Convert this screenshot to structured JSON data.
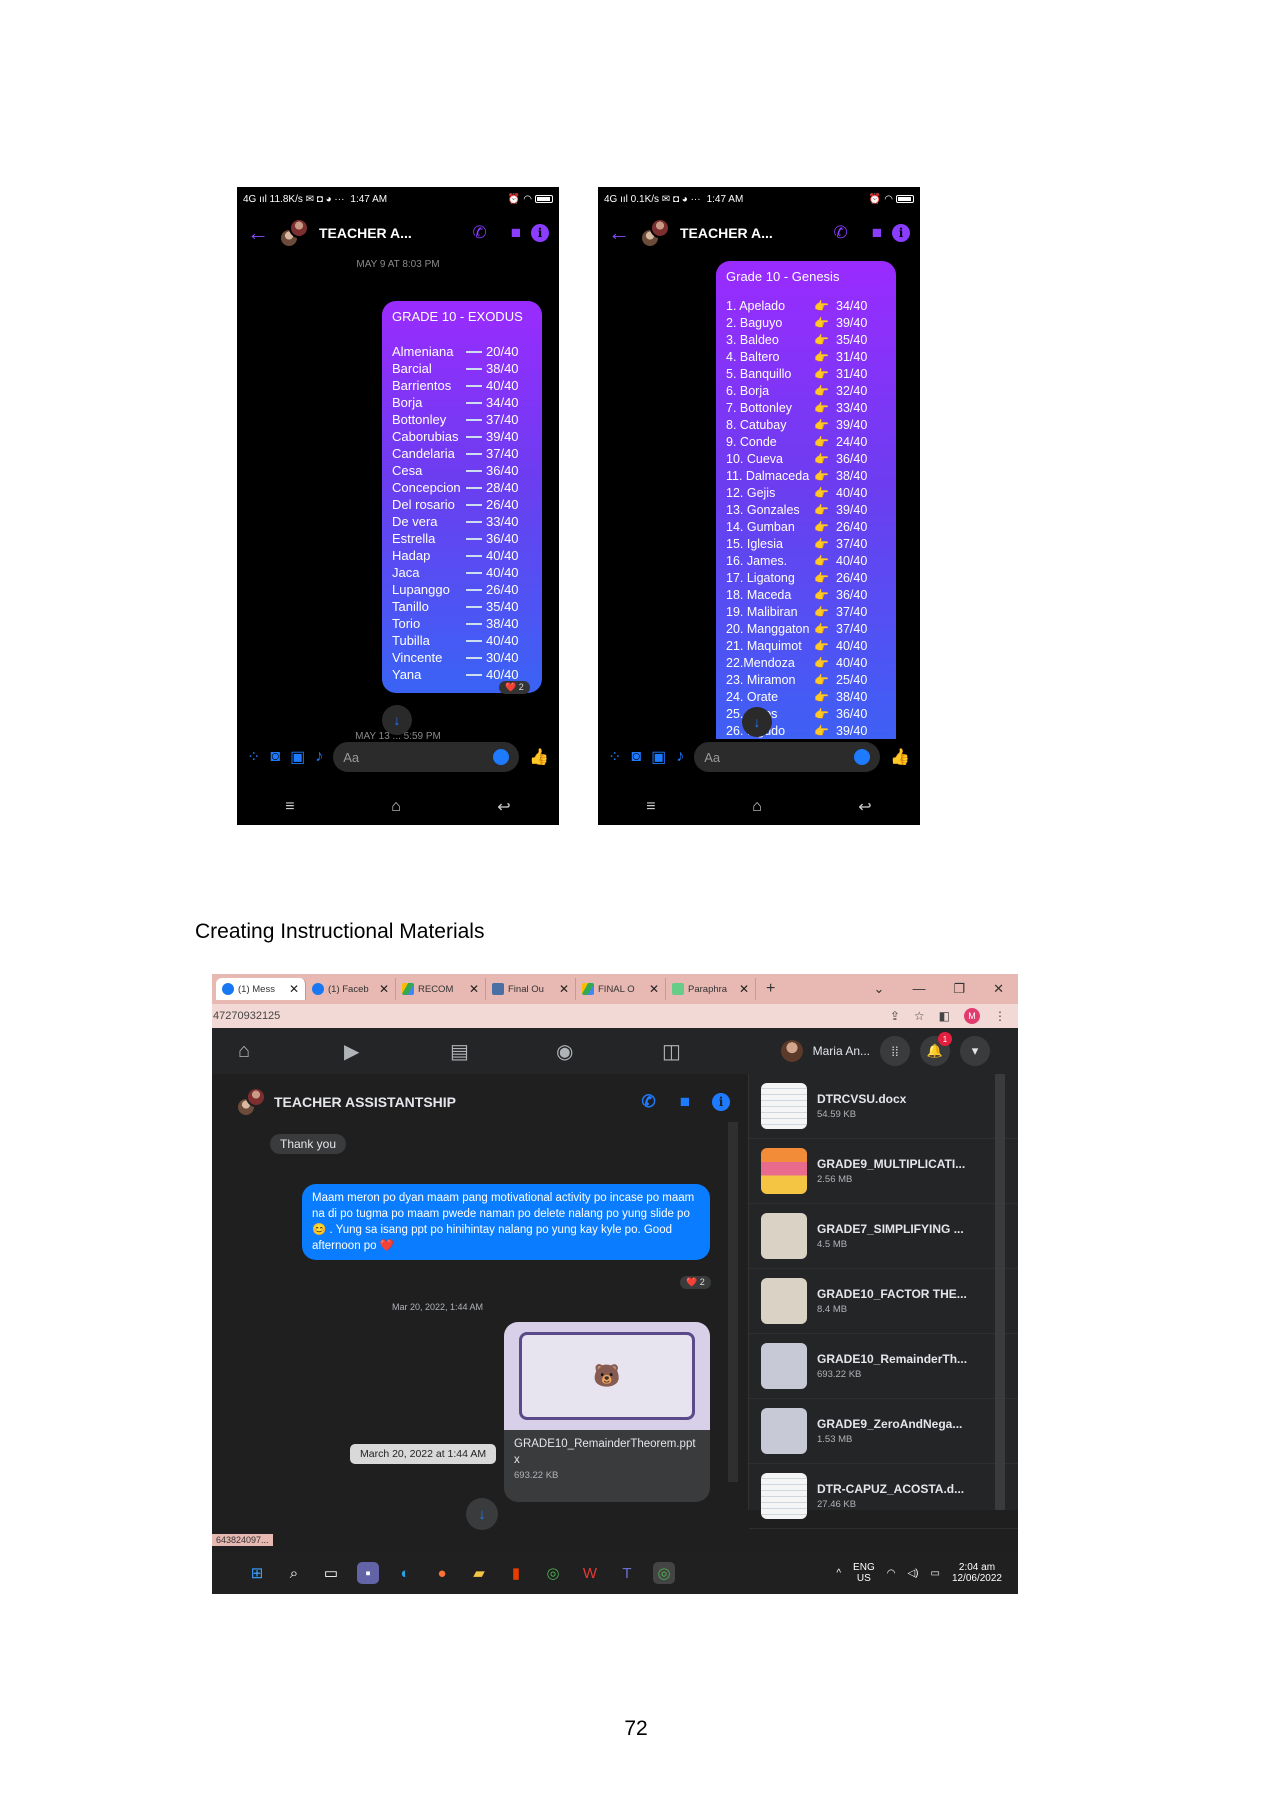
{
  "phone1": {
    "status_left": "4G ııl  11.8K/s ✉ ◘ ◕ ···",
    "status_time": "1:47 AM",
    "chat_title": "TEACHER A...",
    "timestamp_top": "MAY 9 AT 8:03 PM",
    "bubble_title": "GRADE 10 - EXODUS",
    "scores": [
      {
        "name": "Almeniana",
        "score": "20/40"
      },
      {
        "name": "Barcial",
        "score": "38/40"
      },
      {
        "name": "Barrientos",
        "score": "40/40"
      },
      {
        "name": "Borja",
        "score": "34/40"
      },
      {
        "name": "Bottonley",
        "score": "37/40"
      },
      {
        "name": "Caborubias",
        "score": "39/40"
      },
      {
        "name": "Candelaria",
        "score": "37/40"
      },
      {
        "name": "Cesa",
        "score": "36/40"
      },
      {
        "name": "Concepcion",
        "score": "28/40"
      },
      {
        "name": "Del rosario",
        "score": "26/40"
      },
      {
        "name": "De vera",
        "score": "33/40"
      },
      {
        "name": "Estrella",
        "score": "36/40"
      },
      {
        "name": "Hadap",
        "score": "40/40"
      },
      {
        "name": "Jaca",
        "score": "40/40"
      },
      {
        "name": "Lupanggo",
        "score": "26/40"
      },
      {
        "name": "Tanillo",
        "score": "35/40"
      },
      {
        "name": "Torio",
        "score": "38/40"
      },
      {
        "name": "Tubilla",
        "score": "40/40"
      },
      {
        "name": "Vincente",
        "score": "30/40"
      },
      {
        "name": "Yana",
        "score": "40/40"
      }
    ],
    "reaction": "❤️ 2",
    "timestamp_bottom": "MAY 13 ... 5:59 PM",
    "compose_placeholder": "Aa"
  },
  "phone2": {
    "status_left": "4G ııl  0.1K/s ✉ ◘ ◕ ···",
    "status_time": "1:47 AM",
    "chat_title": "TEACHER A...",
    "bubble_title": "Grade 10 - Genesis",
    "scores": [
      {
        "name": "1. Apelado",
        "score": "34/40"
      },
      {
        "name": "2. Baguyo",
        "score": "39/40"
      },
      {
        "name": "3. Baldeo",
        "score": "35/40"
      },
      {
        "name": "4. Baltero",
        "score": "31/40"
      },
      {
        "name": "5. Banquillo",
        "score": "31/40"
      },
      {
        "name": "6. Borja",
        "score": "32/40"
      },
      {
        "name": "7. Bottonley",
        "score": "33/40"
      },
      {
        "name": "8. Catubay",
        "score": "39/40"
      },
      {
        "name": "9. Conde",
        "score": "24/40"
      },
      {
        "name": "10. Cueva",
        "score": "36/40"
      },
      {
        "name": "11. Dalmaceda",
        "score": "38/40"
      },
      {
        "name": "12. Gejis",
        "score": "40/40"
      },
      {
        "name": "13. Gonzales",
        "score": "39/40"
      },
      {
        "name": "14. Gumban",
        "score": "26/40"
      },
      {
        "name": "15. Iglesia",
        "score": "37/40"
      },
      {
        "name": "16. James.",
        "score": "40/40"
      },
      {
        "name": "17. Ligatong",
        "score": "26/40"
      },
      {
        "name": "18. Maceda",
        "score": "36/40"
      },
      {
        "name": "19. Malibiran",
        "score": "37/40"
      },
      {
        "name": "20. Manggaton",
        "score": "37/40"
      },
      {
        "name": "21. Maquimot",
        "score": "40/40"
      },
      {
        "name": "22.Mendoza",
        "score": "40/40"
      },
      {
        "name": "23. Miramon",
        "score": "25/40"
      },
      {
        "name": "24. Orate",
        "score": "38/40"
      },
      {
        "name": "25. ...nos",
        "score": "36/40"
      },
      {
        "name": "26. ...gudo",
        "score": "39/40"
      }
    ],
    "compose_placeholder": "Aa"
  },
  "section_heading": "Creating Instructional Materials",
  "desktop": {
    "tabs": [
      {
        "label": "(1) Mess",
        "icon": "facebook-icon"
      },
      {
        "label": "(1) Faceb",
        "icon": "facebook-icon"
      },
      {
        "label": "RECOM",
        "icon": "google-drive-icon"
      },
      {
        "label": "Final Ou",
        "icon": "slides-icon"
      },
      {
        "label": "FINAL O",
        "icon": "google-drive-icon"
      },
      {
        "label": "Paraphra",
        "icon": "paraphrase-icon"
      }
    ],
    "address": "47270932125",
    "profile_initial": "M",
    "user_name": "Maria An...",
    "notification_count": "1",
    "chat_title": "TEACHER ASSISTANTSHIP",
    "thank_you": "Thank you",
    "blue_message": "Maam meron po dyan maam pang motivational activity po incase po maam na di po tugma po maam pwede naman po delete nalang po yung slide po 😊 . Yung sa isang ppt po hinihintay nalang po yung kay kyle po.  Good afternoon po ❤️",
    "blue_reaction": "❤️ 2",
    "date_small": "Mar 20, 2022, 1:44 AM",
    "tooltip": "March 20, 2022 at 1:44 AM",
    "attachment_name": "GRADE10_RemainderTheorem.pptx",
    "attachment_size": "693.22 KB",
    "compose_placeholder": "Aa",
    "link_tip": "643824097...",
    "files": [
      {
        "name": "DTRCVSU.docx",
        "size": "54.59 KB",
        "thumb": "doc"
      },
      {
        "name": "GRADE9_MULTIPLICATI...",
        "size": "2.56 MB",
        "thumb": "ppt1"
      },
      {
        "name": "GRADE7_SIMPLIFYING ...",
        "size": "4.5 MB",
        "thumb": "ppt2"
      },
      {
        "name": "GRADE10_FACTOR THE...",
        "size": "8.4 MB",
        "thumb": "ppt2"
      },
      {
        "name": "GRADE10_RemainderTh...",
        "size": "693.22 KB",
        "thumb": "ppt3"
      },
      {
        "name": "GRADE9_ZeroAndNega...",
        "size": "1.53 MB",
        "thumb": "ppt3"
      },
      {
        "name": "DTR-CAPUZ_ACOSTA.d...",
        "size": "27.46 KB",
        "thumb": "doc"
      }
    ],
    "taskbar_lang": "ENG",
    "taskbar_region": "US",
    "taskbar_time": "2:04 am",
    "taskbar_date": "12/06/2022"
  },
  "page_number": "72"
}
